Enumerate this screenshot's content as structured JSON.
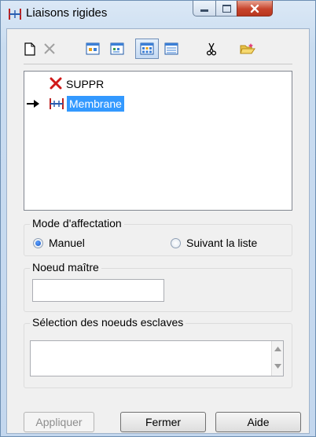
{
  "window": {
    "title": "Liaisons rigides"
  },
  "toolbar": {
    "icons": [
      "new-icon",
      "delete-icon",
      "view-1-icon",
      "view-2-icon",
      "view-grid-icon",
      "view-list-icon",
      "cut-icon",
      "open-folder-icon"
    ]
  },
  "tree": {
    "items": [
      {
        "label": "SUPPR",
        "icon": "red-x-icon"
      },
      {
        "label": "Membrane",
        "icon": "rigid-link-icon",
        "selected": true,
        "current": true
      }
    ]
  },
  "mode": {
    "title": "Mode d'affectation",
    "options": [
      {
        "label": "Manuel",
        "checked": true
      },
      {
        "label": "Suivant la liste",
        "checked": false
      }
    ]
  },
  "master": {
    "title": "Noeud maître",
    "value": ""
  },
  "slaves": {
    "title": "Sélection des noeuds esclaves",
    "value": ""
  },
  "buttons": {
    "apply": "Appliquer",
    "close": "Fermer",
    "help": "Aide"
  },
  "colors": {
    "selection": "#3399ff",
    "close_button": "#c7442c",
    "delete": "#d01818"
  }
}
